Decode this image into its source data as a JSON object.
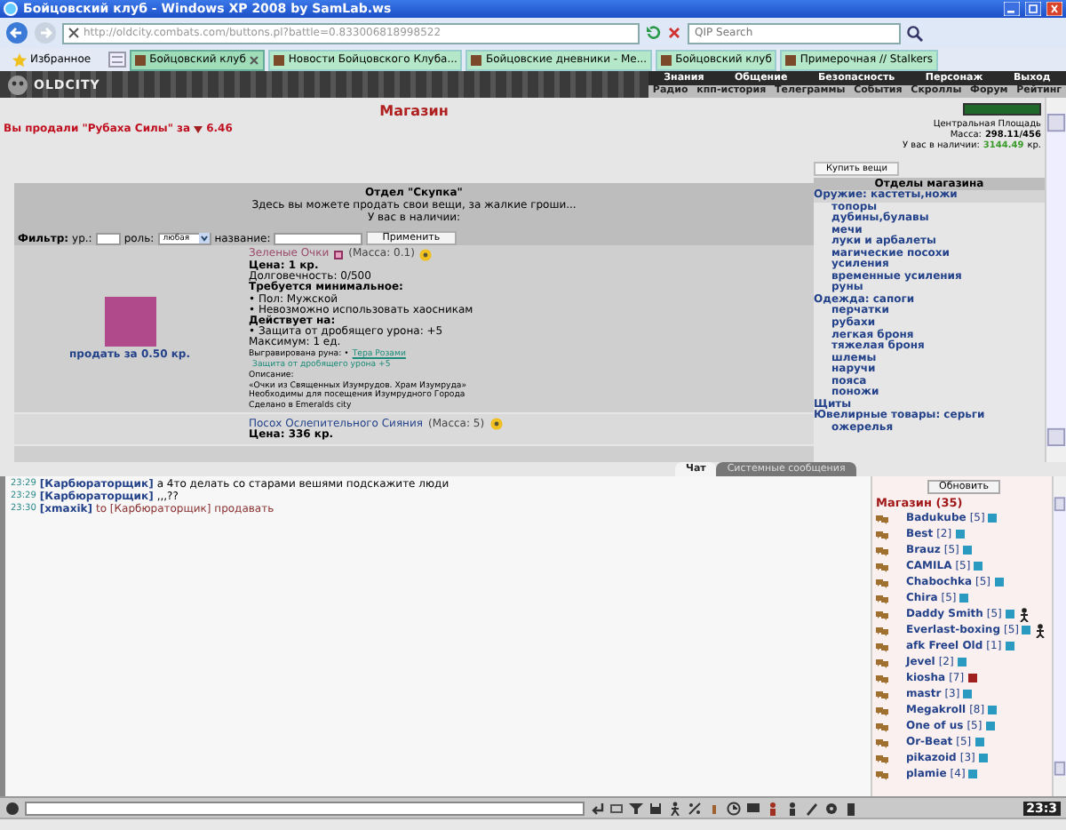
{
  "window": {
    "title": "Бойцовский клуб - Windows XP 2008 by SamLab.ws"
  },
  "browser": {
    "url": "http://oldcity.combats.com/buttons.pl?battle=0.833006818998522",
    "search": {
      "placeholder": "QIP Search"
    },
    "favorites": "Избранное",
    "tabs": [
      {
        "label": "Бойцовский клуб",
        "selected": true
      },
      {
        "label": "Новости Бойцовского Клуба...",
        "selected": false
      },
      {
        "label": "Бойцовские дневники - Ме...",
        "selected": false
      },
      {
        "label": "Бойцовский клуб",
        "selected": false
      },
      {
        "label": "Примерочная // Stalkers",
        "selected": false
      }
    ]
  },
  "game_header": {
    "logo": "OLDCITY",
    "menu_top": [
      "Знания",
      "Общение",
      "Безопасность",
      "Персонаж",
      "Выход"
    ],
    "menu_bottom": [
      "Радио",
      "кпп-история",
      "Телеграммы",
      "События",
      "Скроллы",
      "Форум",
      "Рейтинг"
    ]
  },
  "shop": {
    "title": "Магазин",
    "sold": {
      "text": "Вы продали \"Рубаха Силы\" за",
      "amount": "6.46"
    },
    "location": "Центральная Площадь",
    "mass_label": "Масса:",
    "mass": "298.11/456",
    "cash_label": "У вас в наличии:",
    "cash": "3144.49",
    "cash_unit": "кр.",
    "department": {
      "title": "Отдел \"Скупка\"",
      "note": "Здесь вы можете продать свои вещи, за жалкие гроши...",
      "cash_label": "У вас в наличии:"
    },
    "filter": {
      "label": "Фильтр:",
      "level_label": "ур.:",
      "role_label": "роль:",
      "role_value": "любая",
      "name_label": "название:",
      "apply": "Применить"
    },
    "items": [
      {
        "name": "Зеленые Очки",
        "color": "#9a4a6a",
        "mass": "(Масса: 0.1)",
        "has_image": true,
        "sell": "продать за 0.50 кр.",
        "lines": [
          {
            "kind": "bold",
            "text": "Цена: 1 кр."
          },
          {
            "kind": "text",
            "text": "Долговечность: 0/500"
          },
          {
            "kind": "bold",
            "text": "Требуется минимальное:"
          },
          {
            "kind": "text",
            "text": "• Пол: Мужской"
          },
          {
            "kind": "text",
            "text": "• Невозможно использовать хаосникам"
          },
          {
            "kind": "bold",
            "text": "Действует на:"
          },
          {
            "kind": "text",
            "text": "• Защита от дробящего урона: +5"
          },
          {
            "kind": "text",
            "text": "Максимум: 1 ед."
          },
          {
            "kind": "rune",
            "text": "Выгравирована руна: •",
            "link": "Тера Розами"
          },
          {
            "kind": "effect",
            "text": "Защита от дробящего урона +5"
          },
          {
            "kind": "small",
            "text": "Описание:"
          },
          {
            "kind": "small",
            "text": "«Очки из Священных Изумрудов. Храм Изумруда»"
          },
          {
            "kind": "small",
            "text": "Необходимы для посещения Изумрудного Города"
          },
          {
            "kind": "small",
            "text": "Сделано в Emeralds city"
          }
        ]
      },
      {
        "name": "Посох Ослепительного Сияния",
        "color": "#23428a",
        "mass": "(Масса: 5)",
        "has_image": false,
        "lines": [
          {
            "kind": "bold",
            "text": "Цена: 336 кр."
          }
        ]
      }
    ],
    "buy_button": "Купить вещи",
    "departments_title": "Отделы магазина",
    "departments": [
      {
        "label": "Оружие: кастеты,ножи",
        "selected": true,
        "children": [
          {
            "label": "топоры",
            "selected": false
          },
          {
            "label": "дубины,булавы",
            "selected": false
          },
          {
            "label": "мечи",
            "selected": false
          },
          {
            "label": "луки и арбалеты",
            "selected": false
          },
          {
            "label": "магические посохи",
            "selected": false
          },
          {
            "label": "усиления",
            "selected": false
          },
          {
            "label": "временные усиления",
            "selected": false
          },
          {
            "label": "руны",
            "selected": false
          }
        ]
      },
      {
        "label": "Одежда: сапоги",
        "selected": false,
        "children": [
          {
            "label": "перчатки",
            "selected": false
          },
          {
            "label": "рубахи",
            "selected": false
          },
          {
            "label": "легкая броня",
            "selected": false
          },
          {
            "label": "тяжелая броня",
            "selected": false
          },
          {
            "label": "шлемы",
            "selected": false
          },
          {
            "label": "наручи",
            "selected": false
          },
          {
            "label": "пояса",
            "selected": false
          },
          {
            "label": "поножи",
            "selected": false
          }
        ]
      },
      {
        "label": "Щиты",
        "selected": false
      },
      {
        "label": "Ювелирные товары: серьги",
        "selected": false,
        "children": [
          {
            "label": "ожерелья",
            "selected": false
          }
        ]
      }
    ]
  },
  "chat_tabs": [
    {
      "label": "Чат",
      "selected": true
    },
    {
      "label": "Системные сообщения",
      "selected": false
    }
  ],
  "chat": [
    {
      "time": "23:29",
      "nick": "[Карбюраторщик]",
      "text": "а 4то делать со старами вешями подскажите люди"
    },
    {
      "time": "23:29",
      "nick": "[Карбюраторщик]",
      "text": ",,,??"
    },
    {
      "time": "23:30",
      "nick": "[xmaxik]",
      "to": "to [Карбюраторщик] продавать"
    }
  ],
  "online": {
    "refresh": "Обновить",
    "title": "Магазин (35)",
    "users": [
      {
        "name": "Badukube",
        "level": "[5]",
        "color": "#2a9ac0"
      },
      {
        "name": "Best",
        "level": "[2]",
        "color": "#2a9ac0"
      },
      {
        "name": "Brauz",
        "level": "[5]",
        "color": "#2a9ac0"
      },
      {
        "name": "CAMILA",
        "level": "[5]",
        "color": "#2a9ac0"
      },
      {
        "name": "Chabochka",
        "level": "[5]",
        "color": "#2a9ac0"
      },
      {
        "name": "Chira",
        "level": "[5]",
        "color": "#2a9ac0"
      },
      {
        "name": "Daddy Smith",
        "level": "[5]",
        "color": "#2a9ac0",
        "status_icon": true
      },
      {
        "name": "Everlast-boxing",
        "level": "[5]",
        "color": "#2a9ac0",
        "status_icon": true
      },
      {
        "name": "afk Freel Old",
        "level": "[1]",
        "color": "#2a9ac0"
      },
      {
        "name": "Jevel",
        "level": "[2]",
        "color": "#2a9ac0"
      },
      {
        "name": "kiosha",
        "level": "[7]",
        "color": "#a02020"
      },
      {
        "name": "mastr",
        "level": "[3]",
        "color": "#2a9ac0"
      },
      {
        "name": "Megakroll",
        "level": "[8]",
        "color": "#2a9ac0"
      },
      {
        "name": "One of us",
        "level": "[5]",
        "color": "#2a9ac0"
      },
      {
        "name": "Or-Beat",
        "level": "[5]",
        "color": "#2a9ac0"
      },
      {
        "name": "pikazoid",
        "level": "[3]",
        "color": "#2a9ac0"
      },
      {
        "name": "plamie",
        "level": "[4]",
        "color": "#2a9ac0"
      }
    ]
  },
  "clock": "23:3"
}
